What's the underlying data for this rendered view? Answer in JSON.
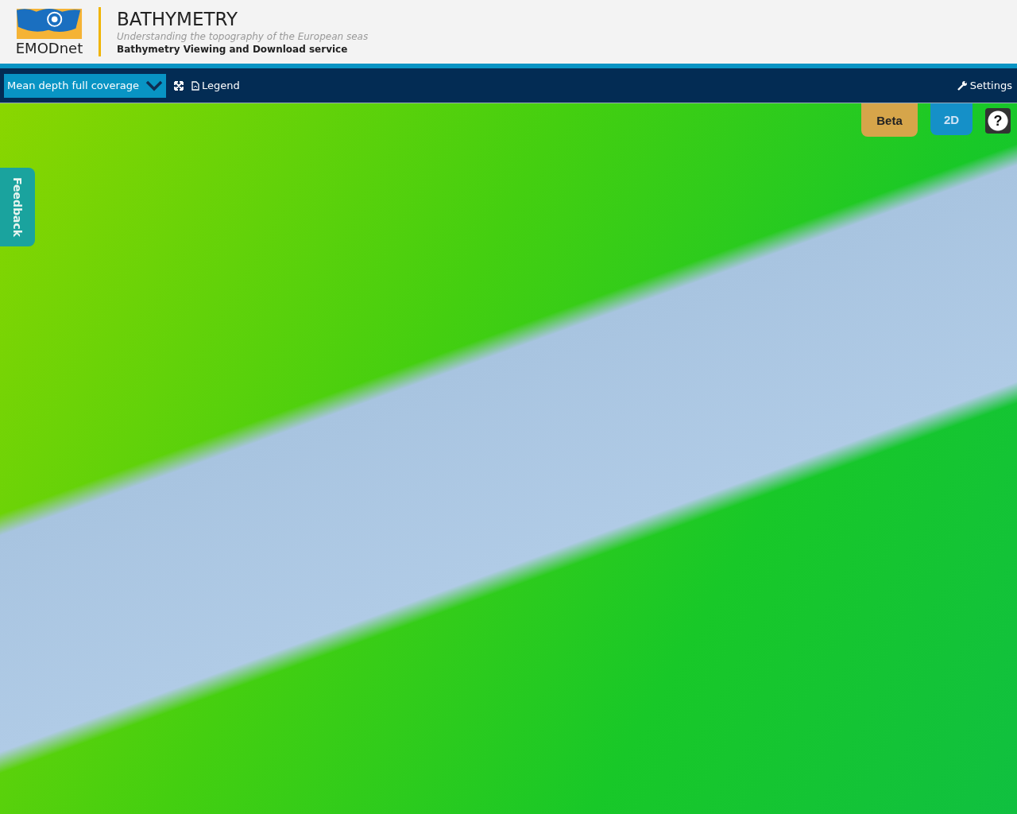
{
  "header": {
    "logo_text": "EMODnet",
    "title": "BATHYMETRY",
    "subtitle": "Understanding the topography of the European seas",
    "service": "Bathymetry Viewing and Download service"
  },
  "toolbar": {
    "layer_select": "Mean depth full coverage",
    "legend": "Legend",
    "settings": "Settings"
  },
  "map": {
    "beta": "Beta",
    "view_mode": "2D",
    "help": "?",
    "feedback": "Feedback"
  }
}
